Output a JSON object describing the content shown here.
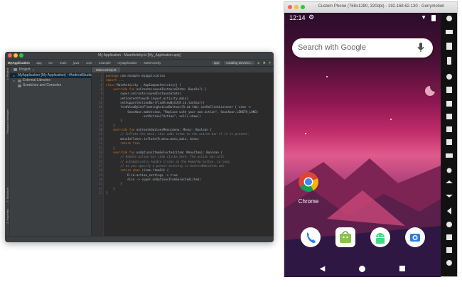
{
  "ide": {
    "window_title": "My Application - MainActivity.kt [My_Application.app]",
    "nav": [
      "MyApplication",
      "app",
      "src",
      "main",
      "java",
      "com",
      "example",
      "myapplication",
      "MainActivity"
    ],
    "run_config": "app",
    "device": "Loading Devices...",
    "project_header": "Project",
    "tree": [
      {
        "label": "MyApplication [My Application]  ~/AndroidStudioProjects/MyApp",
        "level": 0
      },
      {
        "label": "External Libraries",
        "level": 0
      },
      {
        "label": "Scratches and Consoles",
        "level": 0
      }
    ],
    "tab": "MainActivity.kt",
    "left_tabs": [
      "1: Project",
      "Resource Manager",
      "7: Structure",
      "2: Favorites",
      "Build Variants"
    ],
    "code_lines": [
      {
        "n": "1",
        "t": "package com.example.myapplication"
      },
      {
        "n": "2",
        "t": ""
      },
      {
        "n": "3",
        "t": "import ..."
      },
      {
        "n": "4",
        "t": ""
      },
      {
        "n": "5",
        "t": "class MainActivity : AppCompatActivity() {"
      },
      {
        "n": "6",
        "t": ""
      },
      {
        "n": "7",
        "t": "    override fun onCreate(savedInstanceState: Bundle?) {"
      },
      {
        "n": "8",
        "t": "        super.onCreate(savedInstanceState)"
      },
      {
        "n": "9",
        "t": "        setContentView(R.layout.activity_main)"
      },
      {
        "n": "10",
        "t": "        setSupportActionBar(findViewById(R.id.toolbar))"
      },
      {
        "n": "11",
        "t": ""
      },
      {
        "n": "12",
        "t": "        findViewById<FloatingActionButton>(R.id.fab).setOnClickListener { view ->"
      },
      {
        "n": "13",
        "t": "            Snackbar.make(view, \"Replace with your own action\", Snackbar.LENGTH_LONG)"
      },
      {
        "n": "14",
        "t": "                    .setAction(\"Action\", null).show()"
      },
      {
        "n": "15",
        "t": "        }"
      },
      {
        "n": "16",
        "t": "    }"
      },
      {
        "n": "17",
        "t": ""
      },
      {
        "n": "18",
        "t": "    override fun onCreateOptionsMenu(menu: Menu): Boolean {"
      },
      {
        "n": "19",
        "t": "        // Inflate the menu; this adds items to the action bar if it is present."
      },
      {
        "n": "20",
        "t": "        menuInflater.inflate(R.menu.menu_main, menu)"
      },
      {
        "n": "21",
        "t": "        return true"
      },
      {
        "n": "22",
        "t": "    }"
      },
      {
        "n": "23",
        "t": ""
      },
      {
        "n": "24",
        "t": "    override fun onOptionsItemSelected(item: MenuItem): Boolean {"
      },
      {
        "n": "25",
        "t": "        // Handle action bar item clicks here. The action bar will"
      },
      {
        "n": "26",
        "t": "        // automatically handle clicks on the Home/Up button, so long"
      },
      {
        "n": "27",
        "t": "        // as you specify a parent activity in AndroidManifest.xml."
      },
      {
        "n": "28",
        "t": "        return when (item.itemId) {"
      },
      {
        "n": "29",
        "t": "            R.id.action_settings -> true"
      },
      {
        "n": "30",
        "t": "            else -> super.onOptionsItemSelected(item)"
      },
      {
        "n": "31",
        "t": "        }"
      },
      {
        "n": "32",
        "t": "    }"
      },
      {
        "n": "33",
        "t": "}"
      }
    ]
  },
  "emulator": {
    "window_title": "Custom Phone (768x1280, 320dpi) - 192.168.62.130 - Genymotion",
    "time": "12:14",
    "search_placeholder": "Search with Google",
    "chrome_label": "Chrome",
    "dock": [
      "phone-icon",
      "store-icon",
      "android-icon",
      "camera-icon"
    ],
    "colors": {
      "accent_pink": "#c02c69",
      "wallpaper_dark": "#2b0c2c"
    }
  }
}
